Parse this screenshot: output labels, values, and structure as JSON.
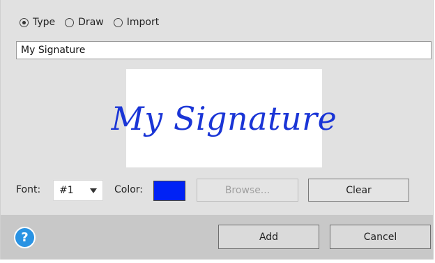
{
  "mode_tabs": [
    {
      "label": "Type",
      "checked": true
    },
    {
      "label": "Draw",
      "checked": false
    },
    {
      "label": "Import",
      "checked": false
    }
  ],
  "signature_text": "My Signature",
  "preview_text": "My Signature",
  "font": {
    "label": "Font:",
    "value": "#1"
  },
  "color": {
    "label": "Color:",
    "value": "#0022f5"
  },
  "buttons": {
    "browse": "Browse...",
    "clear": "Clear",
    "add": "Add",
    "cancel": "Cancel"
  },
  "help_icon_glyph": "?"
}
